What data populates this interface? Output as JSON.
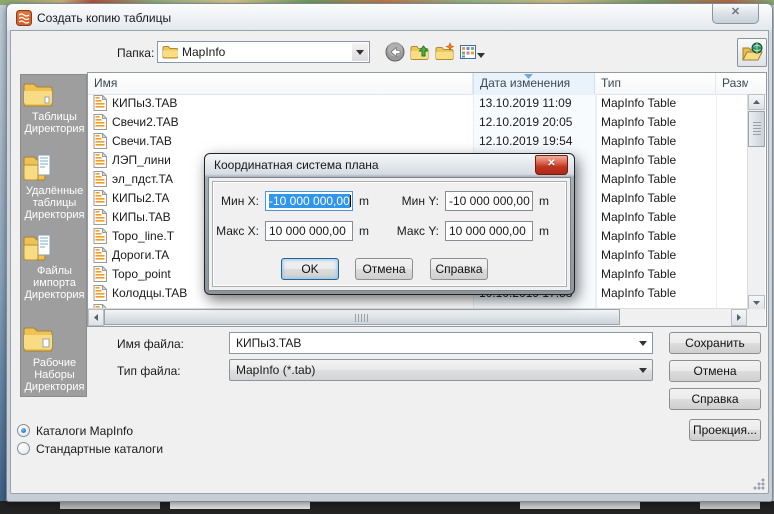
{
  "window": {
    "title": "Создать копию таблицы",
    "close_glyph": "✕"
  },
  "toolbar": {
    "folder_label": "Папка:",
    "folder_value": "MapInfo"
  },
  "sidebar": {
    "items": [
      {
        "label": "Таблицы\nДиректория"
      },
      {
        "label": "Удалённые\nтаблицы\nДиректория"
      },
      {
        "label": "Файлы\nимпорта\nДиректория"
      },
      {
        "label": "Рабочие\nНаборы\nДиректория"
      }
    ]
  },
  "list": {
    "columns": [
      "Имя",
      "Дата изменения",
      "Тип",
      "Разм"
    ],
    "rows": [
      {
        "name": "КИПы3.TAB",
        "date": "13.10.2019 11:09",
        "type": "MapInfo Table"
      },
      {
        "name": "Свечи2.TAB",
        "date": "12.10.2019 20:05",
        "type": "MapInfo Table"
      },
      {
        "name": "Свечи.TAB",
        "date": "12.10.2019 19:54",
        "type": "MapInfo Table"
      },
      {
        "name": "ЛЭП_лини",
        "date": "",
        "type": "MapInfo Table"
      },
      {
        "name": "эл_пдст.TA",
        "date": "",
        "type": "MapInfo Table"
      },
      {
        "name": "КИПы2.TA",
        "date": "",
        "type": "MapInfo Table"
      },
      {
        "name": "КИПы.TAB",
        "date": "",
        "type": "MapInfo Table"
      },
      {
        "name": "Topo_line.T",
        "date": "",
        "type": "MapInfo Table"
      },
      {
        "name": "Дороги.TA",
        "date": "",
        "type": "MapInfo Table"
      },
      {
        "name": "Topo_point",
        "date": "",
        "type": "MapInfo Table"
      },
      {
        "name": "Колодцы.TAB",
        "date": "10.10.2019 17:58",
        "type": "MapInfo Table"
      },
      {
        "name": "",
        "date": "",
        "type": ""
      }
    ]
  },
  "coord_dialog": {
    "title": "Координатная система плана",
    "close_glyph": "✕",
    "fields": [
      {
        "label": "Мин X:",
        "value": "-10 000 000,00",
        "unit": "m"
      },
      {
        "label": "Мин Y:",
        "value": "-10 000 000,00",
        "unit": "m"
      },
      {
        "label": "Макс X:",
        "value": "10 000 000,00",
        "unit": "m"
      },
      {
        "label": "Макс Y:",
        "value": "10 000 000,00",
        "unit": "m"
      }
    ],
    "buttons": {
      "ok": "OK",
      "cancel": "Отмена",
      "help": "Справка"
    }
  },
  "footer": {
    "filename_label": "Имя файла:",
    "filename_value": "КИПы3.TAB",
    "filetype_label": "Тип файла:",
    "filetype_value": "MapInfo (*.tab)",
    "buttons": {
      "save": "Сохранить",
      "cancel": "Отмена",
      "help": "Справка",
      "projection": "Проекция..."
    },
    "radios": [
      {
        "label": "Каталоги MapInfo",
        "selected": true
      },
      {
        "label": "Стандартные каталоги",
        "selected": false
      }
    ]
  },
  "colors": {
    "selection_blue": "#2f96ea",
    "folder_yellow": "#f0c85a",
    "close_red": "#c03522",
    "sidebar_gray": "#9e9e9e"
  }
}
